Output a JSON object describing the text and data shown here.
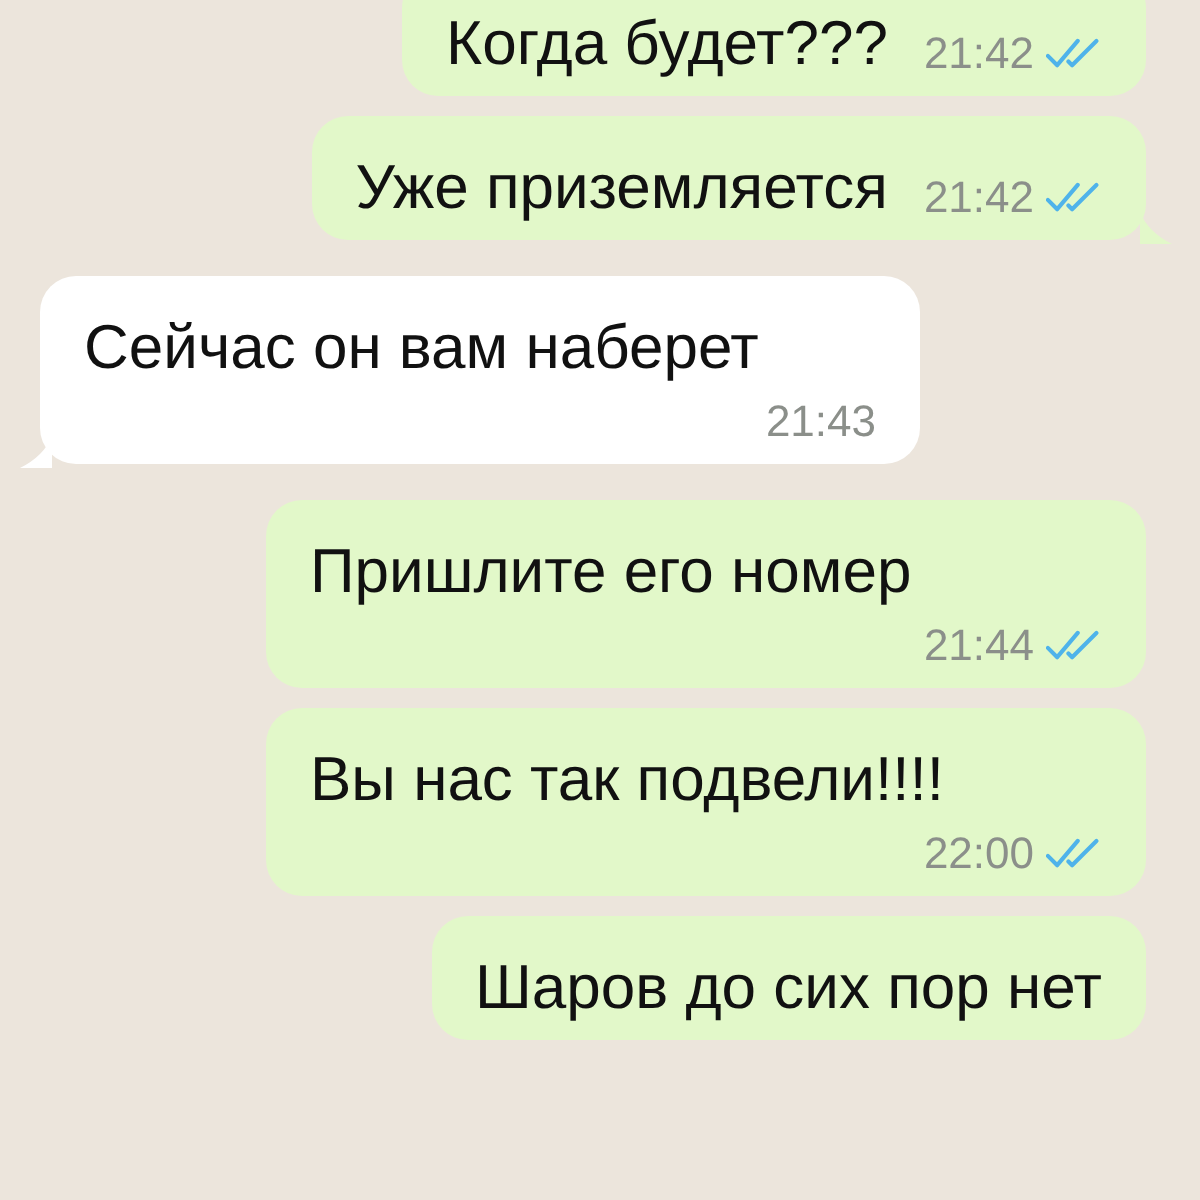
{
  "messages": [
    {
      "kind": "sent",
      "text": "Когда будет???",
      "time": "21:42",
      "read": true,
      "tail": false
    },
    {
      "kind": "sent",
      "text": "Уже приземляется",
      "time": "21:42",
      "read": true,
      "tail": true
    },
    {
      "kind": "received",
      "text": "Сейчас он вам наберет",
      "time": "21:43",
      "tail": true
    },
    {
      "kind": "sent",
      "text": "Пришлите его номер",
      "time": "21:44",
      "read": true,
      "tail": false
    },
    {
      "kind": "sent",
      "text": "Вы нас так подвели!!!!",
      "time": "22:00",
      "read": true,
      "tail": false
    },
    {
      "kind": "sent",
      "text": "Шаров до сих пор нет",
      "tail": false
    }
  ]
}
